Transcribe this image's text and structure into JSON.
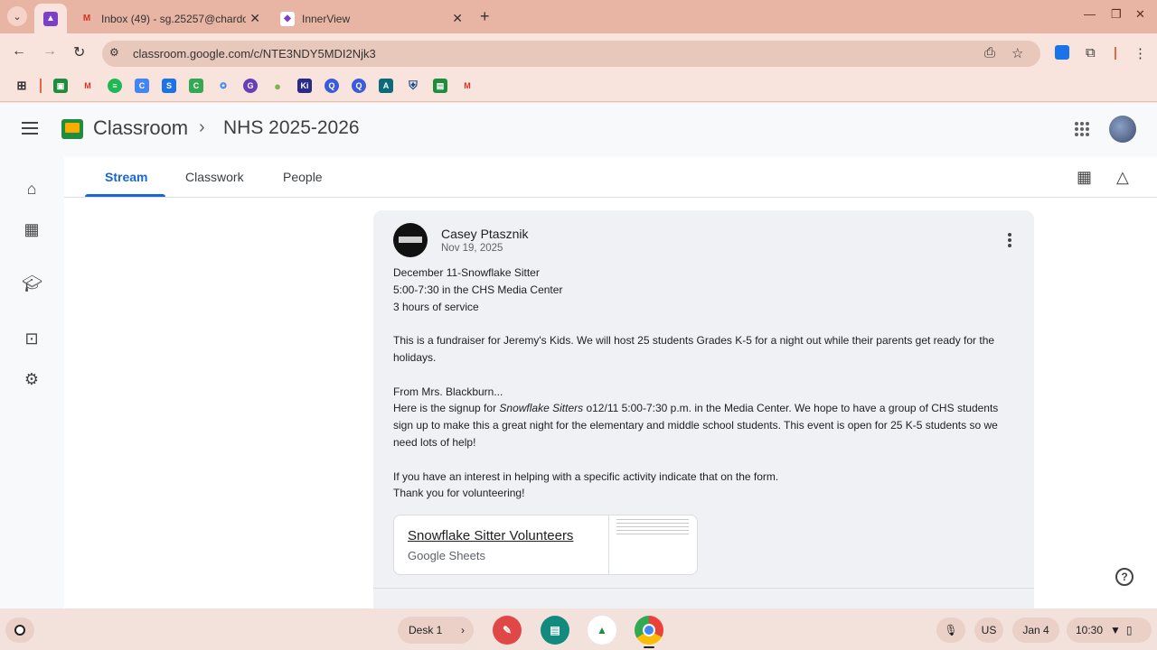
{
  "browser": {
    "tabs": [
      {
        "title": "",
        "active": true
      },
      {
        "title": "Inbox (49) - sg.25257@chardo",
        "active": false
      },
      {
        "title": "InnerView",
        "active": false
      }
    ],
    "url": "classroom.google.com/c/NTE3NDY5MDI2Njk3",
    "bookmark_icons": [
      "classroom",
      "gmail",
      "spotify",
      "c-app",
      "sheets-s",
      "c-green",
      "sense",
      "gg",
      "pear",
      "ki",
      "q1",
      "q2",
      "a",
      "shield",
      "book",
      "gmail2"
    ]
  },
  "app": {
    "title": "Classroom",
    "class_name": "NHS 2025-2026",
    "tabs": [
      "Stream",
      "Classwork",
      "People"
    ],
    "active_tab": "Stream"
  },
  "post": {
    "author": "Casey Ptasznik",
    "date": "Nov 19, 2025",
    "body": {
      "l1": "December 11-Snowflake Sitter",
      "l2": "5:00-7:30 in the CHS Media Center",
      "l3": "3 hours of service",
      "p2": "This is a fundraiser for Jeremy's Kids. We will host 25 students Grades K-5 for a night out while their parents get ready for the holidays.",
      "p3a": "From Mrs. Blackburn...",
      "p3b_pre": "Here is the signup for ",
      "p3b_em": "Snowflake Sitters",
      "p3b_post": " o12/11  5:00-7:30 p.m. in the Media Center. We hope to have a group of CHS students sign up to make this a great night for the elementary and middle school students.  This event is open for 25 K-5 students so we need lots of help!",
      "p4a": "If you have an interest in helping with a specific activity indicate that on the form.",
      "p4b": "Thank you for volunteering!"
    },
    "attachment": {
      "title": "Snowflake Sitter Volunteers",
      "type": "Google Sheets"
    }
  },
  "shelf": {
    "desk": "Desk 1",
    "locale": "US",
    "date": "Jan 4",
    "time": "10:30"
  }
}
